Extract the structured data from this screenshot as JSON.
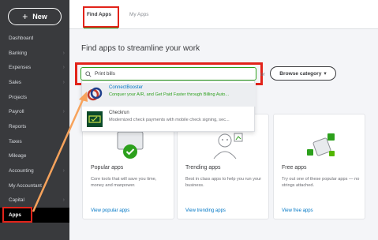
{
  "sidebar": {
    "new_label": "New",
    "items": [
      {
        "label": "Dashboard",
        "has_chevron": false
      },
      {
        "label": "Banking",
        "has_chevron": true
      },
      {
        "label": "Expenses",
        "has_chevron": true
      },
      {
        "label": "Sales",
        "has_chevron": true
      },
      {
        "label": "Projects",
        "has_chevron": false
      },
      {
        "label": "Payroll",
        "has_chevron": true
      },
      {
        "label": "Reports",
        "has_chevron": false
      },
      {
        "label": "Taxes",
        "has_chevron": true
      },
      {
        "label": "Mileage",
        "has_chevron": false
      },
      {
        "label": "Accounting",
        "has_chevron": true
      },
      {
        "label": "My Accountant",
        "has_chevron": false
      },
      {
        "label": "Capital",
        "has_chevron": true
      },
      {
        "label": "Apps",
        "has_chevron": false,
        "active": true
      }
    ]
  },
  "tabs": [
    {
      "label": "Find Apps",
      "active": true
    },
    {
      "label": "My Apps",
      "active": false
    }
  ],
  "main": {
    "title": "Find apps to streamline your work",
    "search": {
      "value": "Print bills"
    },
    "or_text": "or",
    "browse_label": "Browse category"
  },
  "dropdown": [
    {
      "name": "ConnectBooster",
      "desc": "Conquer your A/R, and Get Paid Faster through Billing Auto..."
    },
    {
      "name": "Checkrun",
      "desc": "Modernized check payments with mobile check signing, sec..."
    }
  ],
  "cards": [
    {
      "title": "Popular apps",
      "desc": "Core tools that will save you time, money and manpower.",
      "link": "View popular apps"
    },
    {
      "title": "Trending apps",
      "desc": "Best in class apps to help you run your business.",
      "link": "View trending apps"
    },
    {
      "title": "Free apps",
      "desc": "Try out one of these popular apps — no strings attached.",
      "link": "View free apps"
    }
  ],
  "colors": {
    "sidebar_bg": "#393a3d",
    "accent_green": "#2ca01c",
    "link_blue": "#0077c5",
    "highlight_red": "#e2231a",
    "arrow_orange": "#f7a35c"
  }
}
